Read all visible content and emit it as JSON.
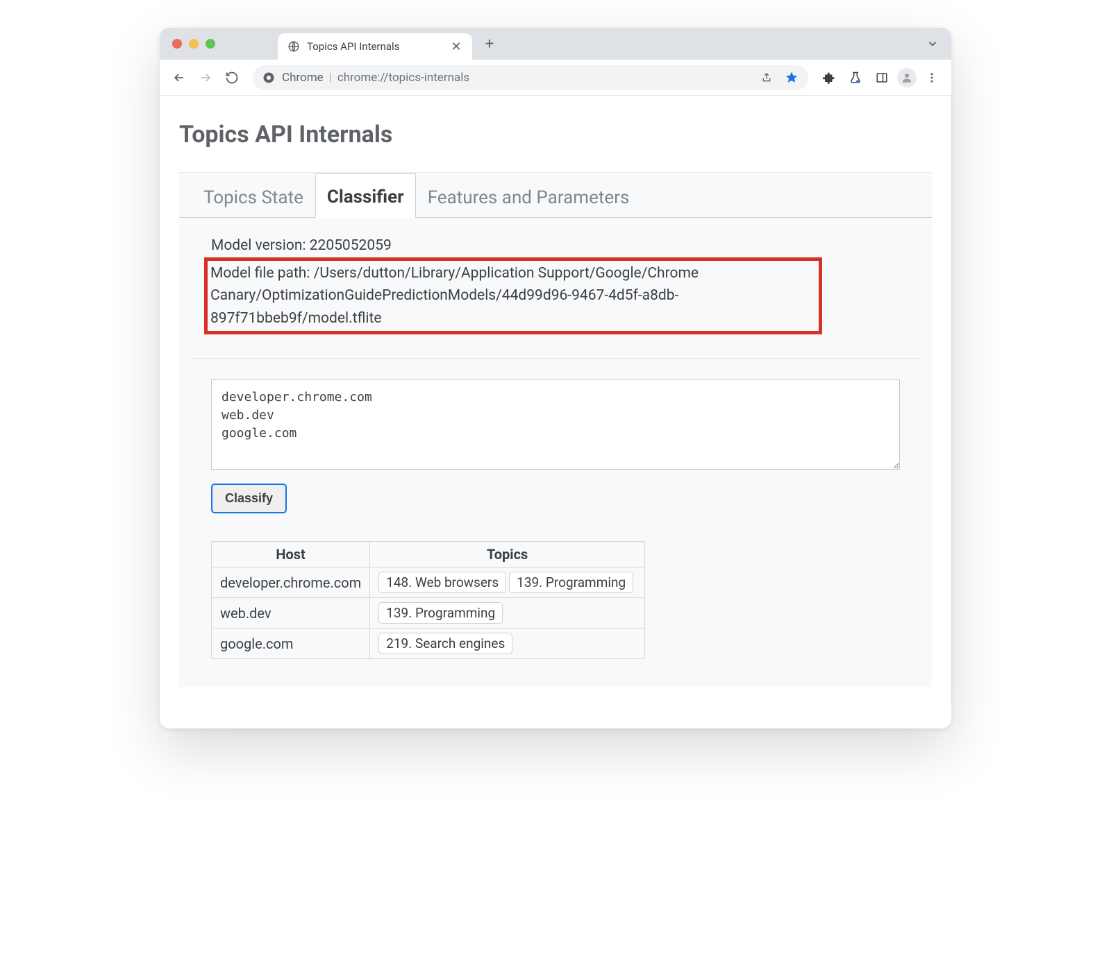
{
  "chrome": {
    "tab_title": "Topics API Internals",
    "omnibox_label": "Chrome",
    "omnibox_url": "chrome://topics-internals"
  },
  "page": {
    "title": "Topics API Internals"
  },
  "tabs": [
    {
      "label": "Topics State"
    },
    {
      "label": "Classifier"
    },
    {
      "label": "Features and Parameters"
    }
  ],
  "model": {
    "version_label": "Model version:",
    "version_value": "2205052059",
    "path_label": "Model file path:",
    "path_value": "/Users/dutton/Library/Application Support/Google/Chrome Canary/OptimizationGuidePredictionModels/44d99d96-9467-4d5f-a8db-897f71bbeb9f/model.tflite"
  },
  "hosts_input": "developer.chrome.com\nweb.dev\ngoogle.com",
  "classify_button": "Classify",
  "results": {
    "header_host": "Host",
    "header_topics": "Topics",
    "rows": [
      {
        "host": "developer.chrome.com",
        "topics": [
          "148. Web browsers",
          "139. Programming"
        ]
      },
      {
        "host": "web.dev",
        "topics": [
          "139. Programming"
        ]
      },
      {
        "host": "google.com",
        "topics": [
          "219. Search engines"
        ]
      }
    ]
  }
}
